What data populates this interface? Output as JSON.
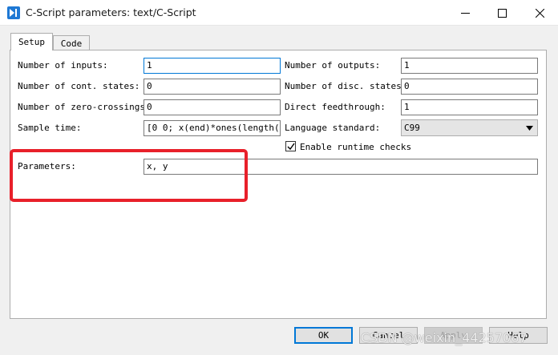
{
  "window": {
    "title": "C-Script parameters: text/C-Script",
    "icon": "play-icon",
    "controls": {
      "minimize": "minimize-icon",
      "maximize": "maximize-icon",
      "close": "close-icon"
    }
  },
  "tabs": [
    {
      "label": "Setup",
      "active": true
    },
    {
      "label": "Code",
      "active": false
    }
  ],
  "form": {
    "number_of_inputs": {
      "label": "Number of inputs:",
      "value": "1"
    },
    "number_of_cont_states": {
      "label": "Number of cont. states:",
      "value": "0"
    },
    "number_of_zero_crossings": {
      "label": "Number of zero-crossings:",
      "value": "0"
    },
    "sample_time": {
      "label": "Sample time:",
      "value": "[0 0; x(end)*ones(length(…"
    },
    "number_of_outputs": {
      "label": "Number of outputs:",
      "value": "1"
    },
    "number_of_disc_states": {
      "label": "Number of disc. states:",
      "value": "0"
    },
    "direct_feedthrough": {
      "label": "Direct feedthrough:",
      "value": "1"
    },
    "language_standard": {
      "label": "Language standard:",
      "value": "C99"
    },
    "runtime_checks": {
      "label": "Enable runtime checks",
      "checked": true
    },
    "parameters": {
      "label": "Parameters:",
      "value": "x, y"
    }
  },
  "buttons": {
    "ok": "OK",
    "cancel": "Cancel",
    "apply": "Apply",
    "help": "Help"
  },
  "watermark": "CSDN @weixin_44257067",
  "colors": {
    "highlight": "#e8202a",
    "accent": "#0078d7",
    "app_icon": "#1e78d4"
  }
}
